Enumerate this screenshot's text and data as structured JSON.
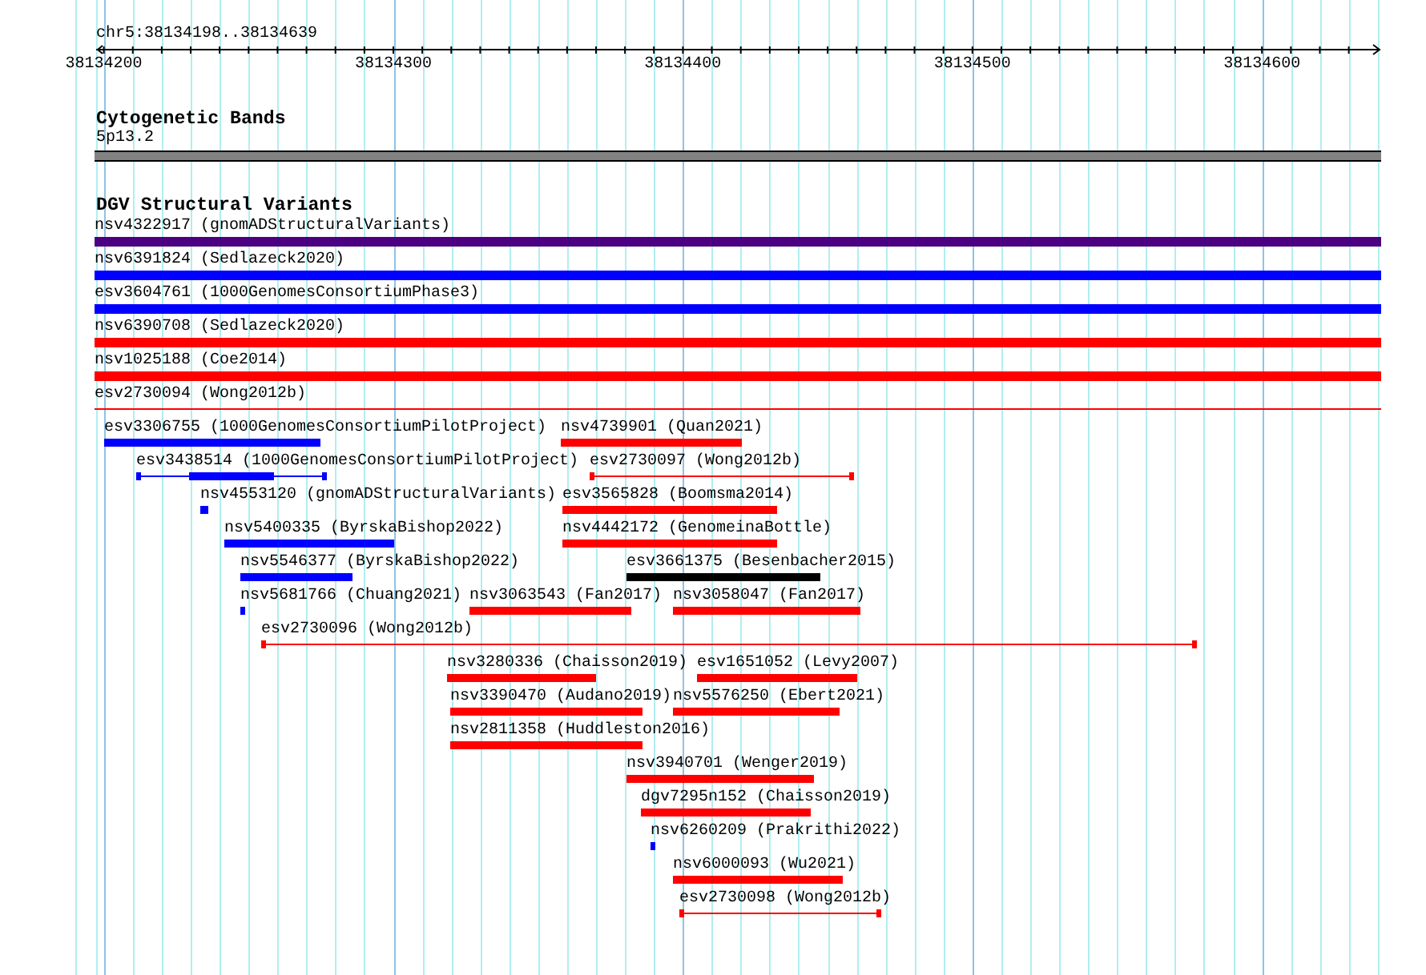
{
  "ruler": {
    "location": "chr5:38134198..38134639",
    "ticks": [
      "38134200",
      "38134300",
      "38134400",
      "38134500",
      "38134600"
    ]
  },
  "tracks": [
    {
      "kind": "cytoband",
      "title": "Cytogenetic Bands",
      "band": "5p13.2"
    },
    {
      "kind": "variants",
      "title": "DGV Structural Variants",
      "rows": [
        {
          "features": [
            {
              "label": "nsv4322917 (gnomADStructuralVariants)",
              "color": "#4b0082",
              "kind": "block"
            }
          ]
        },
        {
          "features": [
            {
              "label": "nsv6391824 (Sedlazeck2020)",
              "color": "#0000ff",
              "kind": "block"
            }
          ]
        },
        {
          "features": [
            {
              "label": "esv3604761 (1000GenomesConsortiumPhase3)",
              "color": "#0000ff",
              "kind": "block"
            }
          ]
        },
        {
          "features": [
            {
              "label": "nsv6390708 (Sedlazeck2020)",
              "color": "#ff0000",
              "kind": "block"
            }
          ]
        },
        {
          "features": [
            {
              "label": "nsv1025188 (Coe2014)",
              "color": "#ff0000",
              "kind": "block"
            }
          ]
        },
        {
          "features": [
            {
              "label": "esv2730094 (Wong2012b)",
              "color": "#ff0000",
              "kind": "line"
            }
          ]
        },
        {
          "features": [
            {
              "label": "esv3306755 (1000GenomesConsortiumPilotProject)",
              "color": "#0000ff",
              "kind": "block"
            },
            {
              "label": "nsv4739901 (Quan2021)",
              "color": "#ff0000",
              "kind": "block"
            }
          ]
        },
        {
          "features": [
            {
              "label": "esv3438514 (1000GenomesConsortiumPilotProject)",
              "color": "#0000ff",
              "kind": "mixed"
            },
            {
              "label": "esv2730097 (Wong2012b)",
              "color": "#ff0000",
              "kind": "line"
            }
          ]
        },
        {
          "features": [
            {
              "label": "nsv4553120 (gnomADStructuralVariants)",
              "color": "#0000ff",
              "kind": "block"
            },
            {
              "label": "esv3565828 (Boomsma2014)",
              "color": "#ff0000",
              "kind": "block"
            }
          ]
        },
        {
          "features": [
            {
              "label": "nsv5400335 (ByrskaBishop2022)",
              "color": "#0000ff",
              "kind": "block"
            },
            {
              "label": "nsv4442172 (GenomeinaBottle)",
              "color": "#ff0000",
              "kind": "block"
            }
          ]
        },
        {
          "features": [
            {
              "label": "nsv5546377 (ByrskaBishop2022)",
              "color": "#0000ff",
              "kind": "block"
            },
            {
              "label": "esv3661375 (Besenbacher2015)",
              "color": "#000000",
              "kind": "block"
            }
          ]
        },
        {
          "features": [
            {
              "label": "nsv5681766 (Chuang2021)",
              "color": "#0000ff",
              "kind": "block"
            },
            {
              "label": "nsv3063543 (Fan2017)",
              "color": "#ff0000",
              "kind": "block"
            },
            {
              "label": "nsv3058047 (Fan2017)",
              "color": "#ff0000",
              "kind": "block"
            }
          ]
        },
        {
          "features": [
            {
              "label": "esv2730096 (Wong2012b)",
              "color": "#ff0000",
              "kind": "line"
            }
          ]
        },
        {
          "features": [
            {
              "label": "nsv3280336 (Chaisson2019)",
              "color": "#ff0000",
              "kind": "block"
            },
            {
              "label": "esv1651052 (Levy2007)",
              "color": "#ff0000",
              "kind": "block"
            }
          ]
        },
        {
          "features": [
            {
              "label": "nsv3390470 (Audano2019)",
              "color": "#ff0000",
              "kind": "block"
            },
            {
              "label": "nsv5576250 (Ebert2021)",
              "color": "#ff0000",
              "kind": "block"
            }
          ]
        },
        {
          "features": [
            {
              "label": "nsv2811358 (Huddleston2016)",
              "color": "#ff0000",
              "kind": "block"
            }
          ]
        },
        {
          "features": [
            {
              "label": "nsv3940701 (Wenger2019)",
              "color": "#ff0000",
              "kind": "block"
            }
          ]
        },
        {
          "features": [
            {
              "label": "dgv7295n152 (Chaisson2019)",
              "color": "#ff0000",
              "kind": "block"
            }
          ]
        },
        {
          "features": [
            {
              "label": "nsv6260209 (Prakrithi2022)",
              "color": "#0000ff",
              "kind": "block"
            }
          ]
        },
        {
          "features": [
            {
              "label": "nsv6000093 (Wu2021)",
              "color": "#ff0000",
              "kind": "block"
            }
          ]
        },
        {
          "features": [
            {
              "label": "esv2730098 (Wong2012b)",
              "color": "#ff0000",
              "kind": "line"
            }
          ]
        }
      ]
    }
  ]
}
